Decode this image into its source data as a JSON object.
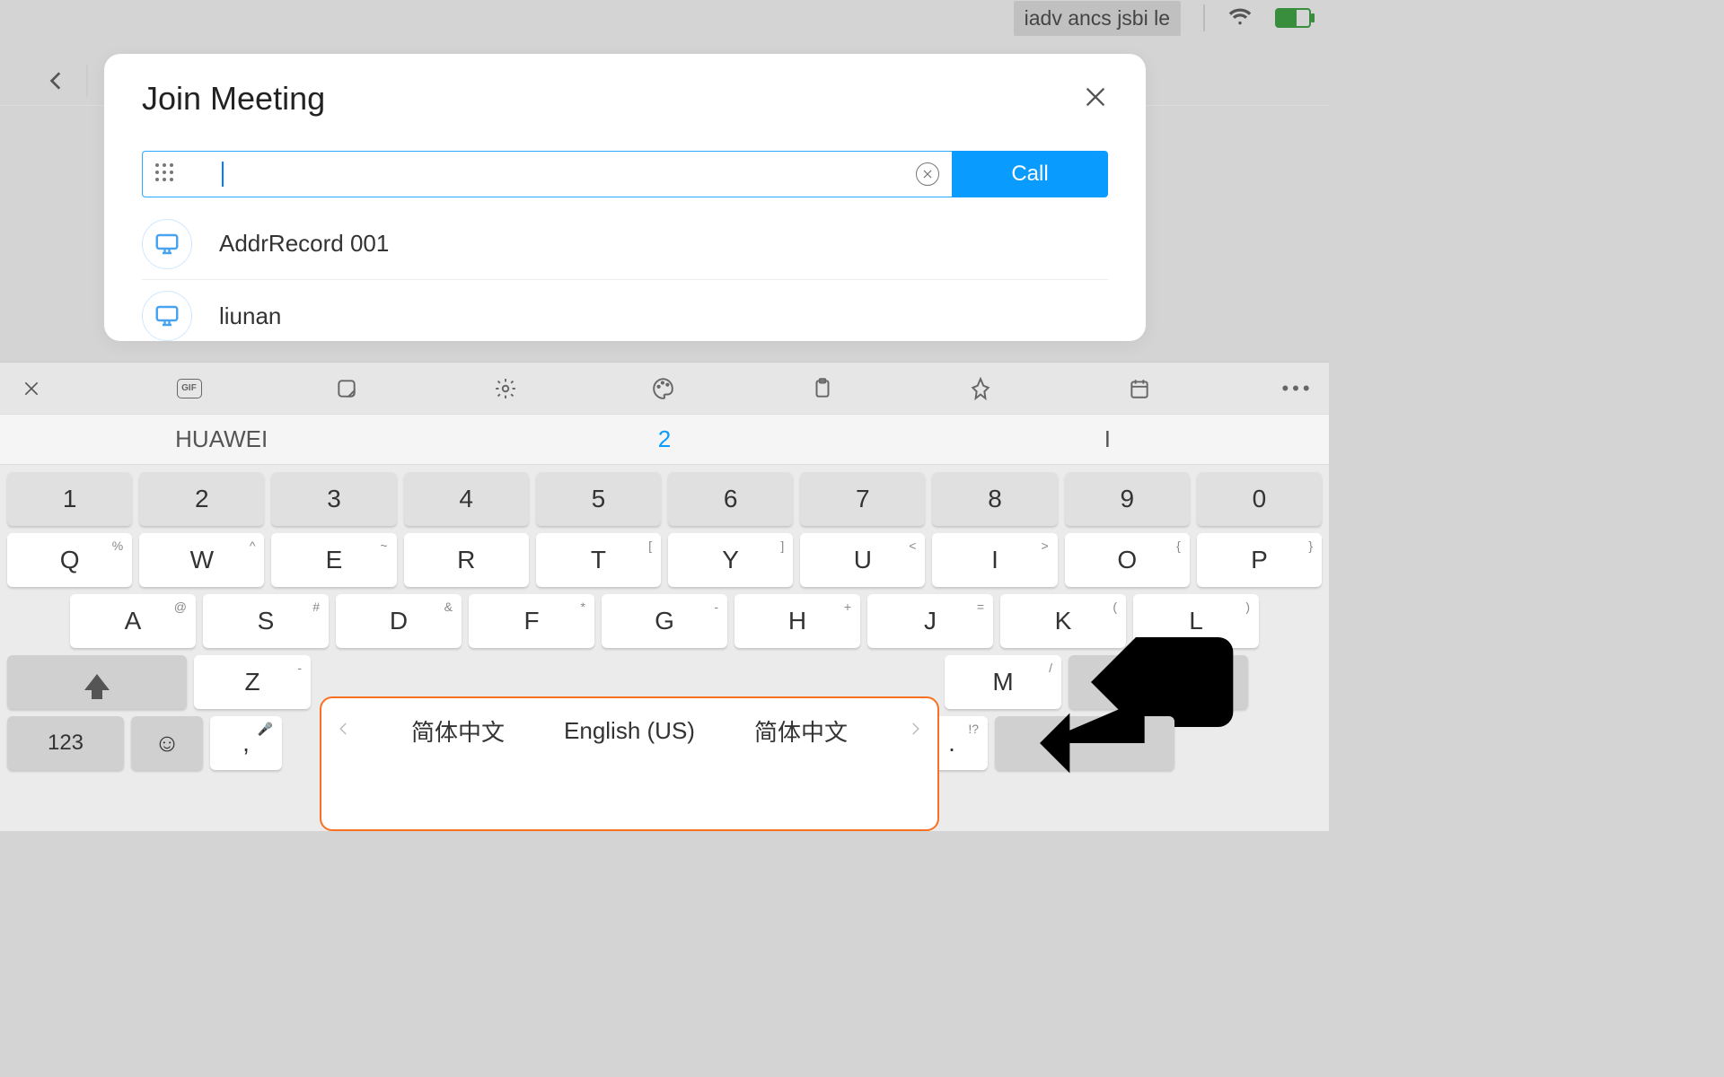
{
  "status": {
    "label": "iadv ancs jsbi le"
  },
  "modal": {
    "title": "Join Meeting",
    "call_label": "Call",
    "results": [
      {
        "label": "AddrRecord 001"
      },
      {
        "label": "liunan"
      }
    ]
  },
  "keyboard": {
    "gif_label": "GIF",
    "suggestions": [
      "HUAWEI",
      "2",
      "I"
    ],
    "row1": [
      "1",
      "2",
      "3",
      "4",
      "5",
      "6",
      "7",
      "8",
      "9",
      "0"
    ],
    "row2": [
      {
        "k": "Q",
        "s": "%"
      },
      {
        "k": "W",
        "s": "^"
      },
      {
        "k": "E",
        "s": "~"
      },
      {
        "k": "R",
        "s": ""
      },
      {
        "k": "T",
        "s": "["
      },
      {
        "k": "Y",
        "s": "]"
      },
      {
        "k": "U",
        "s": "<"
      },
      {
        "k": "I",
        "s": ">"
      },
      {
        "k": "O",
        "s": "{"
      },
      {
        "k": "P",
        "s": "}"
      }
    ],
    "row3": [
      {
        "k": "A",
        "s": "@"
      },
      {
        "k": "S",
        "s": "#"
      },
      {
        "k": "D",
        "s": "&"
      },
      {
        "k": "F",
        "s": "*"
      },
      {
        "k": "G",
        "s": "-"
      },
      {
        "k": "H",
        "s": "+"
      },
      {
        "k": "J",
        "s": "="
      },
      {
        "k": "K",
        "s": "("
      },
      {
        "k": "L",
        "s": ")"
      }
    ],
    "z": {
      "k": "Z",
      "s": "-"
    },
    "m": {
      "k": "M",
      "s": "/"
    },
    "sym_label": "123",
    "comma": ",",
    "dot": ".",
    "dot_sup": "!?",
    "lang": {
      "left": "简体中文",
      "center": "English (US)",
      "right": "简体中文"
    }
  }
}
